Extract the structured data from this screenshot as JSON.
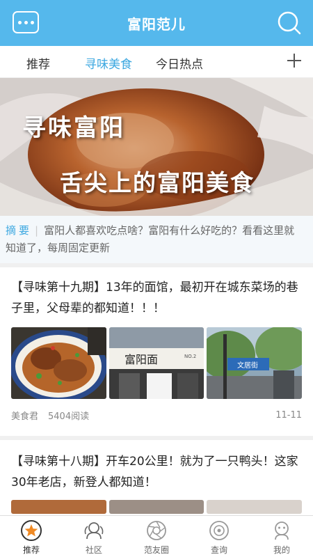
{
  "header": {
    "title": "富阳范儿"
  },
  "tabs": [
    {
      "label": "推荐"
    },
    {
      "label": "寻味美食"
    },
    {
      "label": "今日热点"
    }
  ],
  "banner": {
    "line1": "寻味富阳",
    "line2": "舌尖上的富阳美食"
  },
  "summary": {
    "label": "摘要",
    "text": "富阳人都喜欢吃点啥？富阳有什么好吃的？看看这里就知道了，每周固定更新"
  },
  "articles": [
    {
      "title": "【寻味第十九期】13年的面馆，最初开在城东菜场的巷子里，父母辈的都知道！！！",
      "author": "美食君",
      "reads": "5404阅读",
      "date": "11-11",
      "thumb_labels": {
        "shop_sign": "富阳面",
        "street_sign": "文居街",
        "store_no": "NO.2"
      }
    },
    {
      "title": "【寻味第十八期】开车20公里！就为了一只鸭头！这家30年老店，新登人都知道！"
    }
  ],
  "bottom_nav": [
    {
      "label": "推荐",
      "icon": "star-icon"
    },
    {
      "label": "社区",
      "icon": "community-icon"
    },
    {
      "label": "范友圈",
      "icon": "aperture-icon"
    },
    {
      "label": "查询",
      "icon": "query-icon"
    },
    {
      "label": "我的",
      "icon": "profile-icon"
    }
  ],
  "colors": {
    "primary": "#55b8ec",
    "accent": "#3ba7e0",
    "active_icon": "#f08a24"
  }
}
